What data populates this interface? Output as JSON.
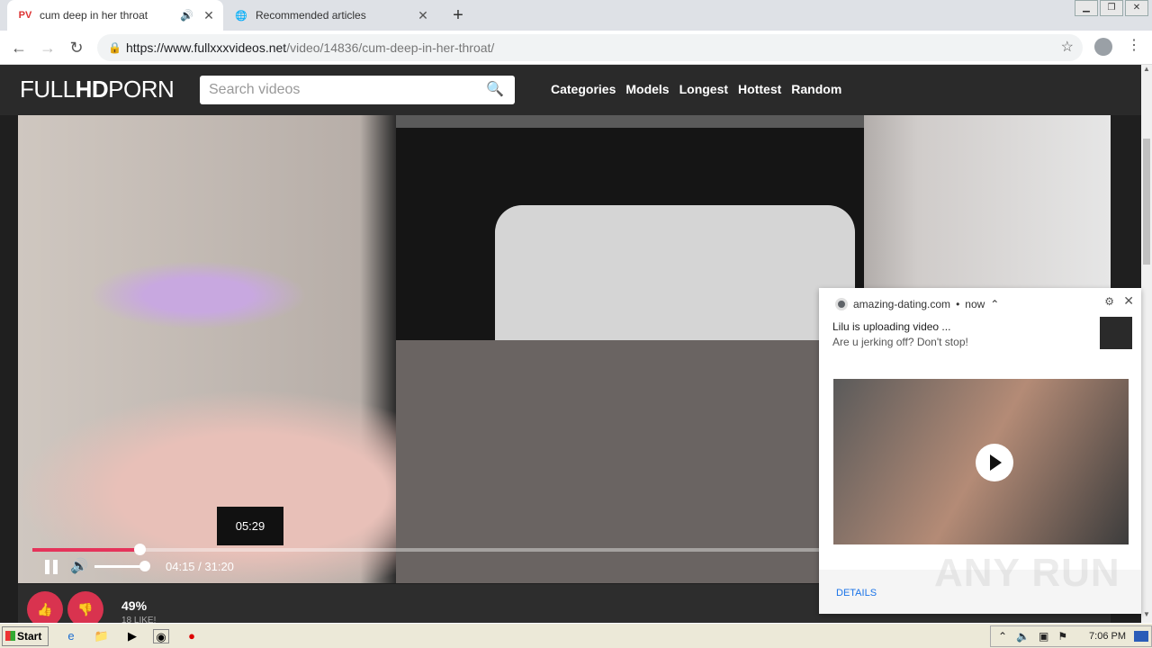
{
  "browser": {
    "tabs": [
      {
        "favicon": "PV",
        "title": "cum deep in her throat",
        "active": true,
        "audio": true
      },
      {
        "favicon": "globe-icon",
        "title": "Recommended articles",
        "active": false
      }
    ],
    "url_host": "https://www.fullxxxvideos.net",
    "url_path": "/video/14836/cum-deep-in-her-throat/"
  },
  "site": {
    "logo_light": "FULL",
    "logo_bold": "HD",
    "logo_rest": "PORN",
    "search_placeholder": "Search videos",
    "nav": [
      "Categories",
      "Models",
      "Longest",
      "Hottest",
      "Random"
    ]
  },
  "player": {
    "tooltip_time": "05:29",
    "time_display": "04:15 / 31:20",
    "progress_fraction": 0.1357,
    "volume_fraction": 0.95
  },
  "rating": {
    "percent": "49%",
    "likes": "18 LIKE!"
  },
  "notification": {
    "source": "amazing-dating.com",
    "when": "now",
    "title": "Lilu is uploading video ...",
    "body": "Are u jerking off? Don't stop!",
    "action": "DETAILS"
  },
  "watermark": "ANY RUN",
  "taskbar": {
    "start_label": "Start",
    "clock": "7:06 PM"
  }
}
